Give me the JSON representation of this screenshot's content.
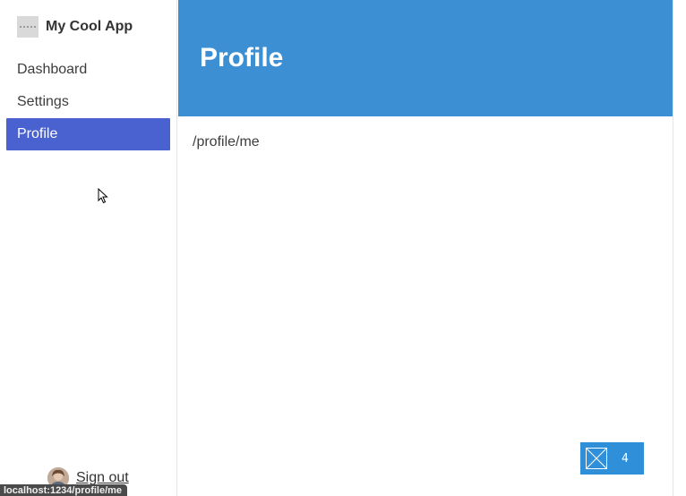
{
  "app": {
    "name": "My Cool App",
    "logo_icon": "placeholder-logo-icon"
  },
  "sidebar": {
    "items": [
      {
        "label": "Dashboard",
        "active": false
      },
      {
        "label": "Settings",
        "active": false
      },
      {
        "label": "Profile",
        "active": true
      }
    ],
    "signout": {
      "label": "Sign out",
      "avatar_icon": "user-avatar"
    }
  },
  "header": {
    "title": "Profile"
  },
  "main": {
    "path": "/profile/me"
  },
  "widget": {
    "icon": "envelope-icon",
    "count": "4"
  },
  "status_bar": {
    "url": "localhost:1234/profile/me"
  },
  "colors": {
    "header_bg": "#3d8fd3",
    "active_nav_bg": "#4a62d0",
    "widget_bg": "#2f8fd8"
  }
}
